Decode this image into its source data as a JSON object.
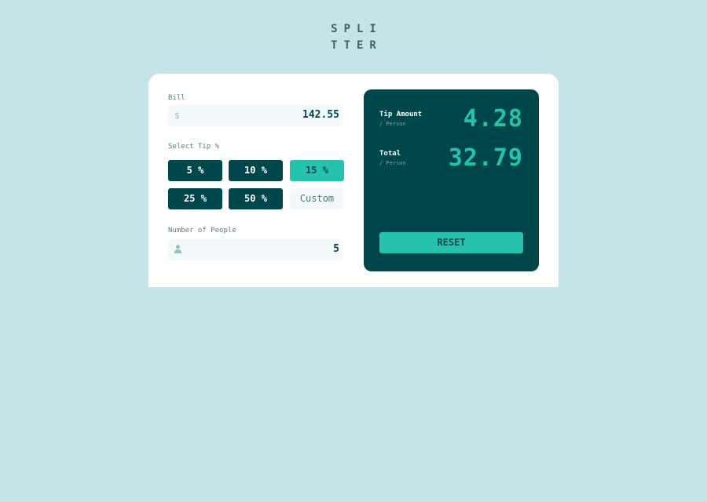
{
  "logo": {
    "line1": "SPLI",
    "line2": "TTER"
  },
  "bill": {
    "label": "Bill",
    "currency_icon": "dollar-icon",
    "currency_symbol": "$",
    "value": "142.55"
  },
  "tip": {
    "label": "Select Tip %",
    "options": [
      {
        "label": "5 %",
        "state": "default"
      },
      {
        "label": "10 %",
        "state": "default"
      },
      {
        "label": "15 %",
        "state": "selected"
      },
      {
        "label": "25 %",
        "state": "default"
      },
      {
        "label": "50 %",
        "state": "default"
      },
      {
        "label": "Custom",
        "state": "custom"
      }
    ]
  },
  "people": {
    "label": "Number of People",
    "icon": "person-icon",
    "value": "5"
  },
  "results": {
    "tip_amount": {
      "label": "Tip Amount",
      "sublabel": "/ Person",
      "value": "4.28"
    },
    "total": {
      "label": "Total",
      "sublabel": "/ Person",
      "value": "32.79"
    },
    "reset_label": "RESET"
  },
  "colors": {
    "background": "#c5e4e7",
    "dark": "#00474b",
    "accent": "#26c2ad",
    "input_bg": "#f3f9fa"
  }
}
